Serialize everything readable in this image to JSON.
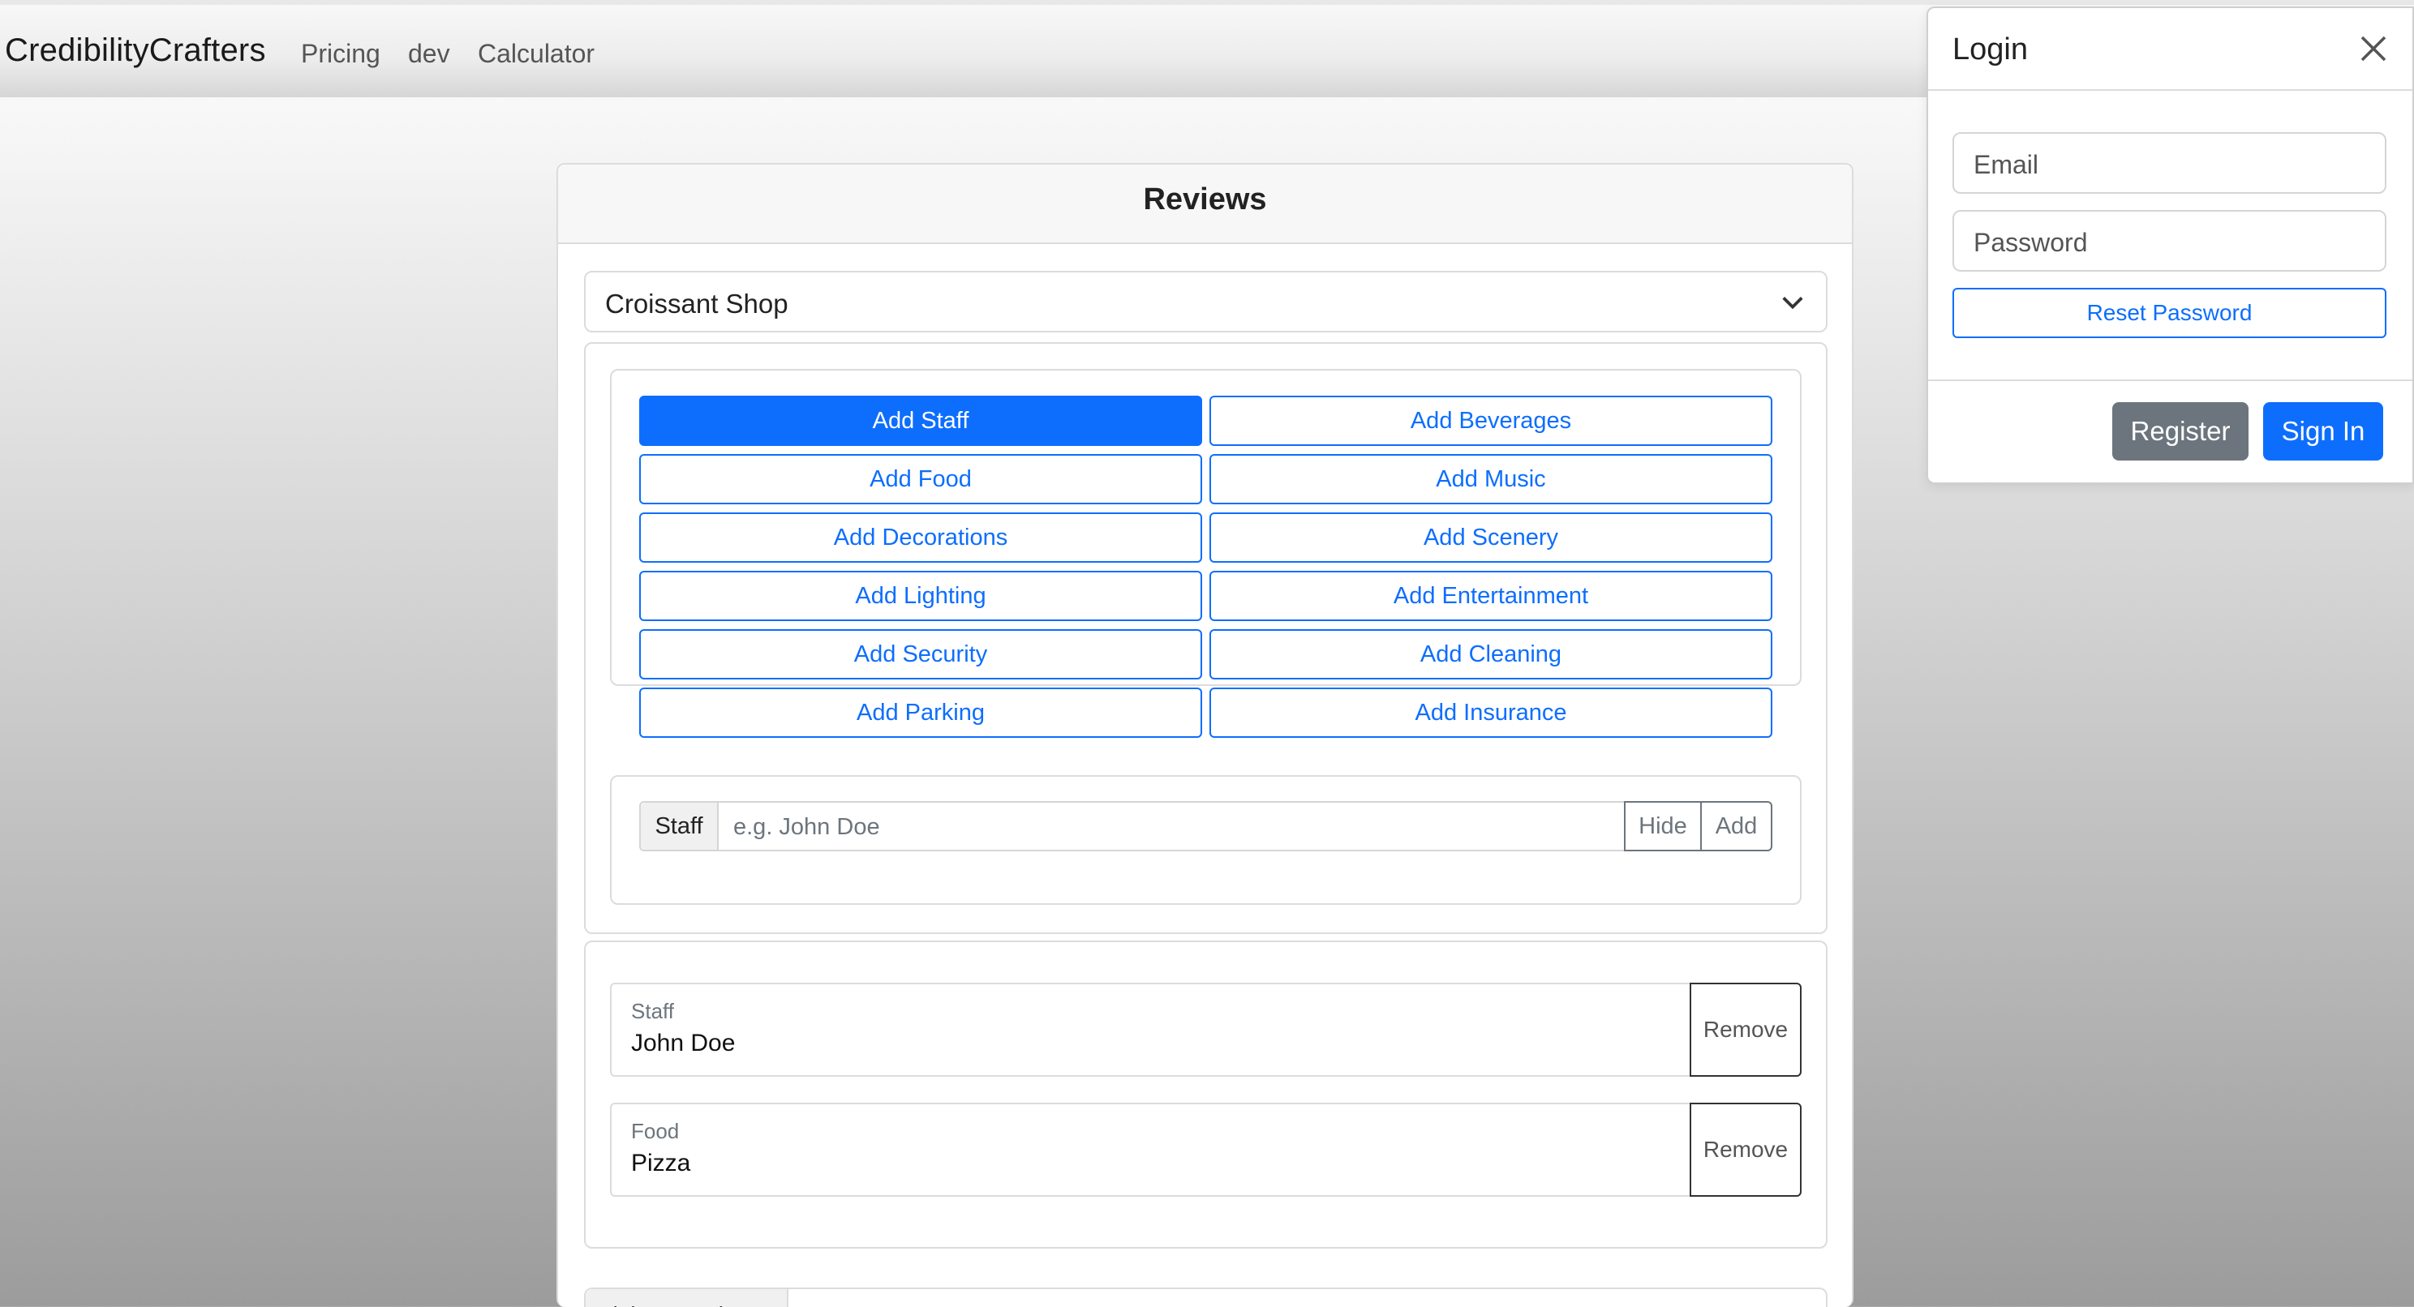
{
  "navbar": {
    "brand": "CredibilityCrafters",
    "links": [
      "Pricing",
      "dev",
      "Calculator"
    ]
  },
  "reviews": {
    "title": "Reviews",
    "selected_shop": "Croissant Shop",
    "add_buttons": [
      "Add Staff",
      "Add Beverages",
      "Add Food",
      "Add Music",
      "Add Decorations",
      "Add Scenery",
      "Add Lighting",
      "Add Entertainment",
      "Add Security",
      "Add Cleaning",
      "Add Parking",
      "Add Insurance"
    ],
    "active_button": "Add Staff",
    "input_group": {
      "label": "Staff",
      "placeholder": "e.g. John Doe",
      "hide_label": "Hide",
      "add_label": "Add"
    },
    "items": [
      {
        "category": "Staff",
        "value": "John Doe",
        "remove_label": "Remove"
      },
      {
        "category": "Food",
        "value": "Pizza",
        "remove_label": "Remove"
      }
    ],
    "bottom_partial_label": "Link To Review"
  },
  "login": {
    "title": "Login",
    "email_placeholder": "Email",
    "password_placeholder": "Password",
    "reset_label": "Reset Password",
    "register_label": "Register",
    "signin_label": "Sign In"
  },
  "colors": {
    "primary": "#0d6efd",
    "secondary": "#6c757d"
  }
}
